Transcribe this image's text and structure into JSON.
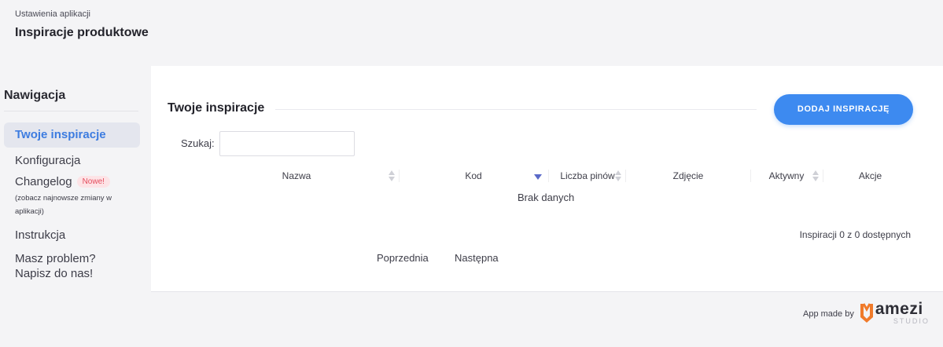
{
  "header": {
    "breadcrumb": "Ustawienia aplikacji",
    "title": "Inspiracje produktowe"
  },
  "sidebar": {
    "title": "Nawigacja",
    "items": {
      "inspiracje": "Twoje inspiracje",
      "konfiguracja": "Konfiguracja",
      "changelog": "Changelog",
      "changelog_badge": "Nowe!",
      "changelog_sub": "(zobacz najnowsze zmiany w aplikacji)",
      "instrukcja": "Instrukcja",
      "problem_1": "Masz problem?",
      "problem_2": "Napisz do nas!"
    }
  },
  "main": {
    "section_title": "Twoje inspiracje",
    "add_button": "DODAJ INSPIRACJĘ",
    "search_label": "Szukaj:",
    "search_value": "",
    "columns": {
      "nazwa": "Nazwa",
      "kod": "Kod",
      "piny": "Liczba pinów",
      "zdjecie": "Zdjęcie",
      "aktywny": "Aktywny",
      "akcje": "Akcje"
    },
    "empty_text": "Brak danych",
    "info_text": "Inspiracji 0 z 0 dostępnych",
    "pagination": {
      "prev": "Poprzednia",
      "next": "Następna"
    }
  },
  "footer": {
    "made_by": "App made by",
    "logo_name": "amezi",
    "logo_sub": "STUDIO"
  },
  "colors": {
    "accent": "#3d8af0",
    "active_nav": "#3d7ce0",
    "badge_bg": "#fde3e6",
    "badge_text": "#e44d5e",
    "logo_orange": "#f07a2a"
  }
}
